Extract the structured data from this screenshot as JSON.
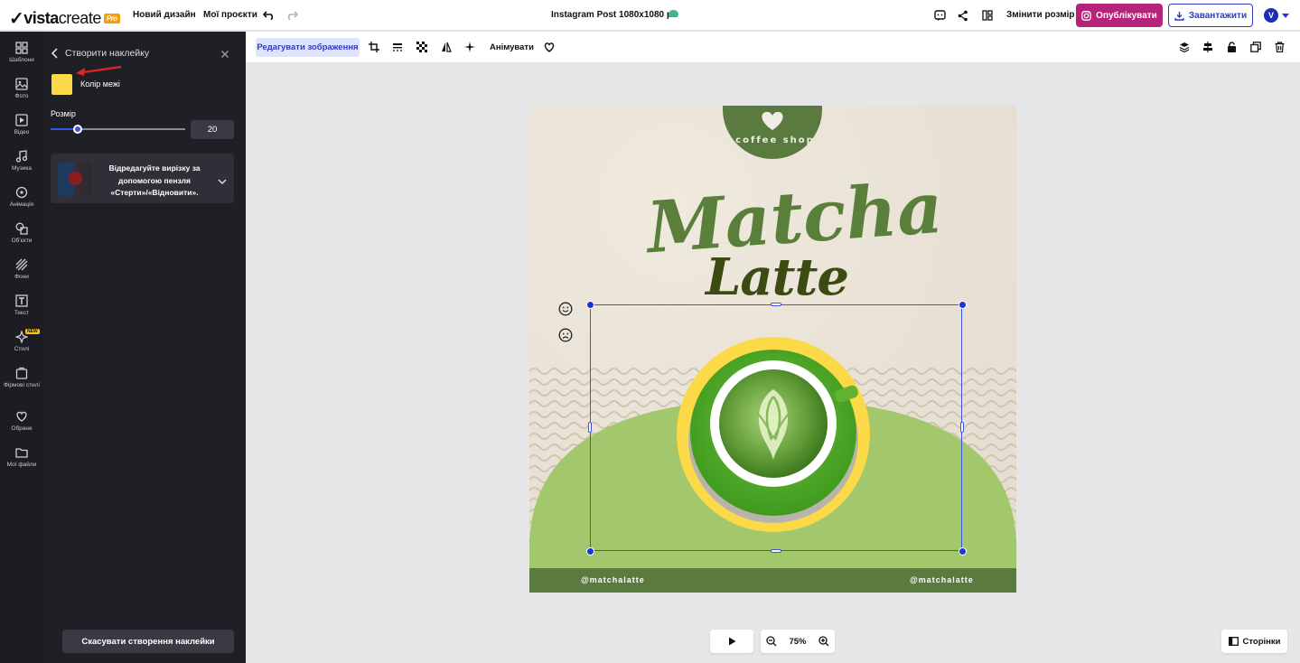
{
  "header": {
    "logo_brand": "vista",
    "logo_suffix": "create",
    "pro_badge": "Pro",
    "new_design": "Новий дизайн",
    "my_projects": "Мої проєкти",
    "doc_title": "Instagram Post 1080x1080 px",
    "resize": "Змінити розмір",
    "publish": "Опублікувати",
    "download": "Завантажити",
    "avatar_initial": "V"
  },
  "leftnav": {
    "items": [
      {
        "label": "Шаблони",
        "icon": "templates-icon"
      },
      {
        "label": "Фото",
        "icon": "photo-icon"
      },
      {
        "label": "Відео",
        "icon": "video-icon"
      },
      {
        "label": "Музика",
        "icon": "music-icon"
      },
      {
        "label": "Анімація",
        "icon": "animation-icon"
      },
      {
        "label": "Об'єкти",
        "icon": "objects-icon"
      },
      {
        "label": "Фони",
        "icon": "backgrounds-icon"
      },
      {
        "label": "Текст",
        "icon": "text-icon"
      },
      {
        "label": "Стилі",
        "icon": "styles-icon"
      },
      {
        "label": "Фірмові стилі",
        "icon": "brand-icon"
      },
      {
        "label": "Обране",
        "icon": "favorites-icon"
      },
      {
        "label": "Мої файли",
        "icon": "files-icon"
      }
    ],
    "new_badge": "NEW"
  },
  "panel": {
    "title": "Створити наклейку",
    "border_color_label": "Колір межі",
    "border_color": "#fcd947",
    "size_label": "Розмір",
    "size_value": "20",
    "size_fraction": 0.2,
    "tip_text": "Відредагуйте вирізку за допомогою пензля «Стерти»/«Відновити».",
    "cancel": "Скасувати створення наклейки"
  },
  "toolbar": {
    "edit_image": "Редагувати зображення",
    "animate": "Анімувати"
  },
  "canvas": {
    "badge_text": "coffee shop",
    "title_line1": "Matcha",
    "title_line2": "Latte",
    "handle_left": "@matchalatte",
    "handle_right": "@matchalatte"
  },
  "bottom": {
    "zoom": "75%",
    "pages": "Сторінки"
  },
  "colors": {
    "accent": "#2e39c4",
    "publish": "#b5247a",
    "brand_green": "#5a7a3f",
    "light_green": "#a3c76c",
    "sticker_border": "#fcd947"
  }
}
